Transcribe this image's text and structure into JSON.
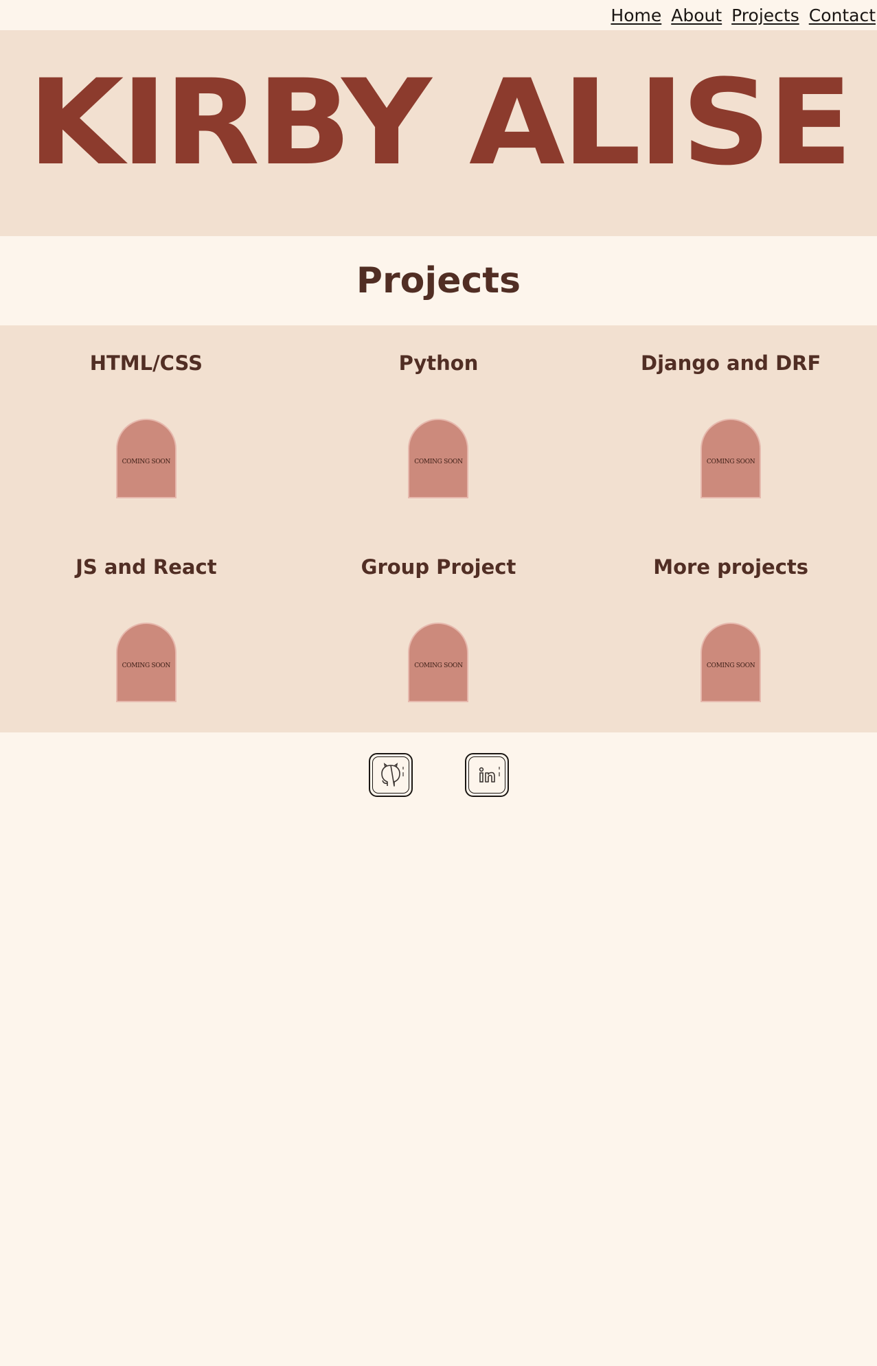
{
  "nav": {
    "items": [
      {
        "label": "Home"
      },
      {
        "label": "About"
      },
      {
        "label": "Projects"
      },
      {
        "label": "Contact"
      }
    ]
  },
  "hero": {
    "title": "KIRBY ALISE"
  },
  "projects": {
    "heading": "Projects",
    "items": [
      {
        "title": "HTML/CSS",
        "badge": "COMING SOON"
      },
      {
        "title": "Python",
        "badge": "COMING SOON"
      },
      {
        "title": "Django and DRF",
        "badge": "COMING SOON"
      },
      {
        "title": "JS and React",
        "badge": "COMING SOON"
      },
      {
        "title": "Group Project",
        "badge": "COMING SOON"
      },
      {
        "title": "More projects",
        "badge": "COMING SOON"
      }
    ]
  },
  "footer": {
    "icons": [
      "github-icon",
      "linkedin-icon"
    ]
  },
  "colors": {
    "background": "#fdf5ec",
    "band": "#f2e0d0",
    "hero_text": "#8c3b2d",
    "heading_text": "#512e24",
    "arch_fill": "#cc8a7c"
  }
}
